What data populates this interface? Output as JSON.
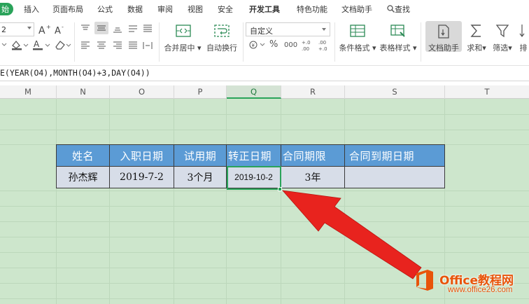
{
  "ribbon": {
    "tabs": [
      {
        "label": "始",
        "active": true
      },
      {
        "label": "插入"
      },
      {
        "label": "页面布局"
      },
      {
        "label": "公式"
      },
      {
        "label": "数据"
      },
      {
        "label": "审阅"
      },
      {
        "label": "视图"
      },
      {
        "label": "安全"
      },
      {
        "label": "开发工具",
        "bold": true
      },
      {
        "label": "特色功能"
      },
      {
        "label": "文档助手"
      }
    ],
    "search_label": "查找"
  },
  "toolbar": {
    "font_size_value": "2",
    "number_format_value": "自定义",
    "merge_center_label": "合并居中",
    "auto_wrap_label": "自动换行",
    "conditional_format_label": "条件格式",
    "table_style_label": "表格样式",
    "doc_assistant_label": "文档助手",
    "sum_label": "求和",
    "filter_label": "筛选",
    "sort_label": "排",
    "percent_label": "%",
    "thousands_label": "000",
    "increase_decimal_label": "+.0\n.00",
    "decrease_decimal_label": ".00\n+.0"
  },
  "formula_bar": {
    "formula_text": "E(YEAR(O4),MONTH(O4)+3,DAY(O4))"
  },
  "columns": {
    "letters": [
      "M",
      "N",
      "O",
      "P",
      "Q",
      "R",
      "S",
      "T"
    ],
    "selected": "Q"
  },
  "table": {
    "headers": [
      "姓名",
      "入职日期",
      "试用期",
      "转正日期",
      "合同期限",
      "合同到期日期"
    ],
    "row": [
      "孙杰辉",
      "2019-7-2",
      "3个月",
      "2019-10-2",
      "3年",
      ""
    ]
  },
  "colors": {
    "accent": "#2aa35a",
    "sheet_background": "#cde6cc",
    "header_fill": "#5b9bd5",
    "data_fill": "#d7dde8",
    "arrow": "#e8231e",
    "watermark": "#e8540a"
  },
  "watermark": {
    "title": "Office教程网",
    "url": "www.office26.com"
  }
}
